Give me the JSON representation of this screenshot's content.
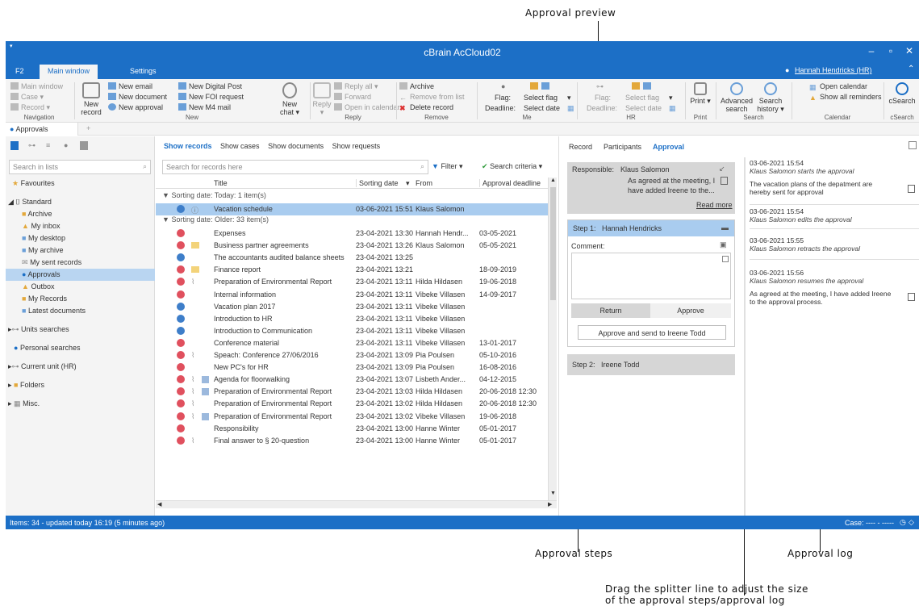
{
  "annotations": {
    "top": "Approval preview",
    "steps": "Approval steps",
    "log": "Approval log",
    "splitter_line1": "Drag the splitter line to adjust the size",
    "splitter_line2": "of the approval steps/approval log"
  },
  "window": {
    "title": "cBrain AcCloud02",
    "user": "Hannah Hendricks (HR)"
  },
  "ribbon_tabs": [
    "F2",
    "Main window",
    "Settings"
  ],
  "ribbon": {
    "navigation": {
      "label": "Navigation",
      "items": [
        "Main window",
        "Case ▾",
        "Record ▾"
      ]
    },
    "new": {
      "label": "New",
      "new_record": "New record",
      "items": [
        "New email",
        "New document",
        "New approval",
        "New Digital Post",
        "New FOI request",
        "New M4 mail"
      ],
      "new_chat": "New chat ▾"
    },
    "reply": {
      "label": "Reply",
      "reply": "Reply ▾",
      "items": [
        "Reply all ▾",
        "Forward",
        "Open in calendar"
      ]
    },
    "remove": {
      "label": "Remove",
      "items": [
        "Archive",
        "Remove from list",
        "Delete record"
      ]
    },
    "me": {
      "label": "Me",
      "flag": "Flag:",
      "deadline": "Deadline:",
      "select_flag": "Select flag",
      "select_date": "Select date"
    },
    "hr": {
      "label": "HR",
      "flag": "Flag:",
      "deadline": "Deadline:",
      "select_flag": "Select flag",
      "select_date": "Select date"
    },
    "print": {
      "label": "Print",
      "btn": "Print ▾"
    },
    "search": {
      "label": "Search",
      "advanced": "Advanced search",
      "history": "Search history ▾"
    },
    "calendar": {
      "label": "Calendar",
      "items": [
        "Open calendar",
        "Show all reminders"
      ]
    },
    "csearch": {
      "label": "cSearch",
      "btn": "cSearch"
    }
  },
  "doc_tab": "Approvals",
  "left": {
    "search_placeholder": "Search in lists",
    "tree": [
      "Favourites",
      "Standard",
      "Archive",
      "My inbox",
      "My desktop",
      "My archive",
      "My sent records",
      "Approvals",
      "Outbox",
      "My Records",
      "Latest documents",
      "Units searches",
      "Personal searches",
      "Current unit (HR)",
      "Folders",
      "Misc."
    ]
  },
  "list": {
    "tabs": [
      "Show records",
      "Show cases",
      "Show documents",
      "Show requests"
    ],
    "search_placeholder": "Search for records here",
    "filter": "Filter ▾",
    "criteria": "Search criteria ▾",
    "headers": [
      "Title",
      "Sorting date",
      "From",
      "Approval deadline"
    ],
    "group1": "Sorting date: Today: 1 item(s)",
    "group2": "Sorting date: Older: 33 item(s)",
    "rows": [
      [
        "Vacation schedule",
        "03-06-2021 15:51",
        "Klaus Salomon",
        ""
      ],
      [
        "Expenses",
        "23-04-2021 13:30",
        "Hannah Hendr...",
        "03-05-2021"
      ],
      [
        "Business partner agreements",
        "23-04-2021 13:26",
        "Klaus Salomon",
        "05-05-2021"
      ],
      [
        "The accountants audited balance sheets",
        "23-04-2021 13:25",
        "",
        ""
      ],
      [
        "Finance report",
        "23-04-2021 13:21",
        "",
        "18-09-2019"
      ],
      [
        "Preparation of Environmental Report",
        "23-04-2021 13:11",
        "Hilda Hildasen",
        "19-06-2018"
      ],
      [
        "Internal information",
        "23-04-2021 13:11",
        "Vibeke Villasen",
        "14-09-2017"
      ],
      [
        "Vacation plan 2017",
        "23-04-2021 13:11",
        "Vibeke Villasen",
        ""
      ],
      [
        "Introduction to HR",
        "23-04-2021 13:11",
        "Vibeke Villasen",
        ""
      ],
      [
        "Introduction to Communication",
        "23-04-2021 13:11",
        "Vibeke Villasen",
        ""
      ],
      [
        "Conference material",
        "23-04-2021 13:11",
        "Vibeke Villasen",
        "13-01-2017"
      ],
      [
        "Speach: Conference 27/06/2016",
        "23-04-2021 13:09",
        "Pia Poulsen",
        "05-10-2016"
      ],
      [
        "New PC's for HR",
        "23-04-2021 13:09",
        "Pia Poulsen",
        "16-08-2016"
      ],
      [
        "Agenda for floorwalking",
        "23-04-2021 13:07",
        "Lisbeth Ander...",
        "04-12-2015"
      ],
      [
        "Preparation of Environmental Report",
        "23-04-2021 13:03",
        "Hilda Hildasen",
        "20-06-2018 12:30"
      ],
      [
        "Preparation of Environmental Report",
        "23-04-2021 13:02",
        "Hilda Hildasen",
        "20-06-2018 12:30"
      ],
      [
        "Preparation of Environmental Report",
        "23-04-2021 13:02",
        "Vibeke Villasen",
        "19-06-2018"
      ],
      [
        "Responsibility",
        "23-04-2021 13:00",
        "Hanne Winter",
        "05-01-2017"
      ],
      [
        "Final answer to § 20-question",
        "23-04-2021 13:00",
        "Hanne Winter",
        "05-01-2017"
      ]
    ]
  },
  "right": {
    "tabs": [
      "Record",
      "Participants",
      "Approval"
    ],
    "responsible_label": "Responsible:",
    "responsible_name": "Klaus Salomon",
    "responsible_text1": "As agreed at the meeting, I",
    "responsible_text2": "have added Ireene to the...",
    "read_more": "Read more",
    "step1_label": "Step 1:",
    "step1_name": "Hannah Hendricks",
    "comment_label": "Comment:",
    "return_btn": "Return",
    "approve_btn": "Approve",
    "approve_send_btn": "Approve and send to Ireene Todd",
    "step2_label": "Step 2:",
    "step2_name": "Ireene Todd",
    "log": [
      {
        "time": "03-06-2021 15:54",
        "action": "Klaus Salomon starts the approval",
        "note": "The vacation plans of the depatment are hereby sent for approval"
      },
      {
        "time": "03-06-2021 15:54",
        "action": "Klaus Salomon edits the approval",
        "note": ""
      },
      {
        "time": "03-06-2021 15:55",
        "action": "Klaus Salomon retracts the approval",
        "note": ""
      },
      {
        "time": "03-06-2021 15:56",
        "action": "Klaus Salomon resumes the approval",
        "note": "As agreed at the meeting, I have added Ireene to the approval process."
      }
    ]
  },
  "status": {
    "left": "Items: 34 - updated today 16:19 (5 minutes ago)",
    "right": "Case: ---- - -----"
  }
}
